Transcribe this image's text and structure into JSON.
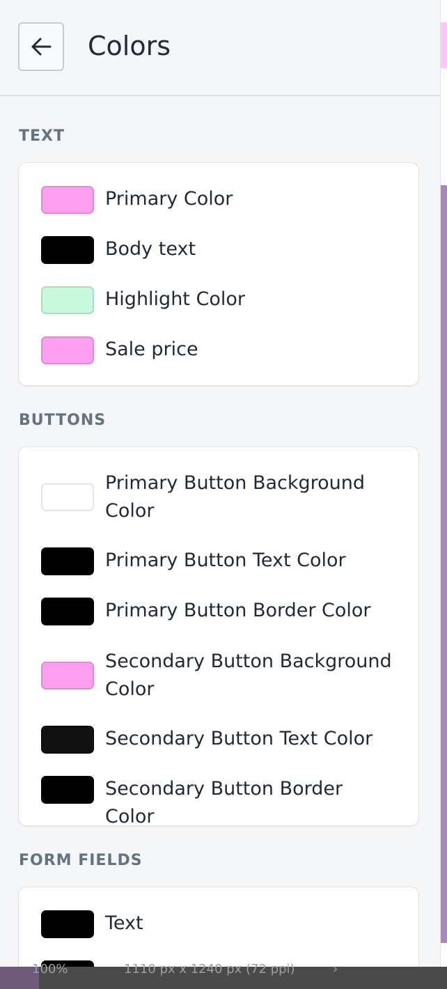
{
  "header": {
    "title": "Colors",
    "back_icon": "arrow-left-icon"
  },
  "sections": {
    "text": {
      "label": "TEXT",
      "items": [
        {
          "label": "Primary Color",
          "color": "#ff9ff0"
        },
        {
          "label": "Body text",
          "color": "#000000"
        },
        {
          "label": "Highlight Color",
          "color": "#c8f9dc"
        },
        {
          "label": "Sale price",
          "color": "#ff9ff0"
        }
      ]
    },
    "buttons": {
      "label": "BUTTONS",
      "items": [
        {
          "label": "Primary Button Background Color",
          "color": "#ffffff"
        },
        {
          "label": "Primary Button Text Color",
          "color": "#000000"
        },
        {
          "label": "Primary Button Border Color",
          "color": "#000000"
        },
        {
          "label": "Secondary Button Background Color",
          "color": "#ff9ff0"
        },
        {
          "label": "Secondary Button Text Color",
          "color": "#111111"
        },
        {
          "label": "Secondary Button Border Color",
          "color": "#000000"
        }
      ]
    },
    "form_fields": {
      "label": "FORM FIELDS",
      "items": [
        {
          "label": "Text",
          "color": "#000000"
        },
        {
          "label": "",
          "color": "#000000"
        }
      ]
    }
  },
  "status_bar": {
    "zoom": "100%",
    "dimensions": "1110 px x 1240 px (72 ppi)",
    "chevron": "›"
  }
}
